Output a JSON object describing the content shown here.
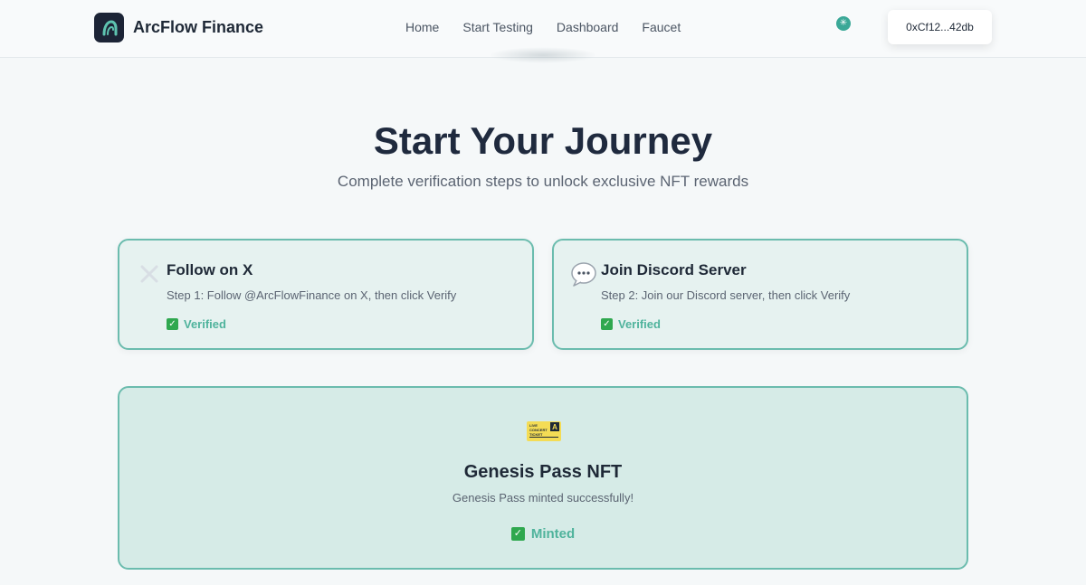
{
  "header": {
    "brand": "ArcFlow Finance",
    "nav": [
      {
        "label": "Home"
      },
      {
        "label": "Start Testing"
      },
      {
        "label": "Dashboard"
      },
      {
        "label": "Faucet"
      }
    ],
    "wallet_address": "0xCf12...42db"
  },
  "hero": {
    "title": "Start Your Journey",
    "subtitle": "Complete verification steps to unlock exclusive NFT rewards"
  },
  "steps": [
    {
      "icon": "x-logo-icon",
      "title": "Follow on X",
      "description": "Step 1: Follow @ArcFlowFinance on X, then click Verify",
      "status": "Verified"
    },
    {
      "icon": "speech-bubble-icon",
      "title": "Join Discord Server",
      "description": "Step 2: Join our Discord server, then click Verify",
      "status": "Verified"
    }
  ],
  "nft": {
    "icon": "ticket-icon",
    "ticket_text": "LIVE CONCERT TICKET",
    "ticket_badge": "A",
    "title": "Genesis Pass NFT",
    "description": "Genesis Pass minted successfully!",
    "status": "Minted"
  },
  "colors": {
    "accent": "#3aa897",
    "card_bg": "#e6f2f0",
    "card_border": "#6bbcae",
    "status_text": "#4fb39c",
    "logo_bg": "#1c2436"
  }
}
